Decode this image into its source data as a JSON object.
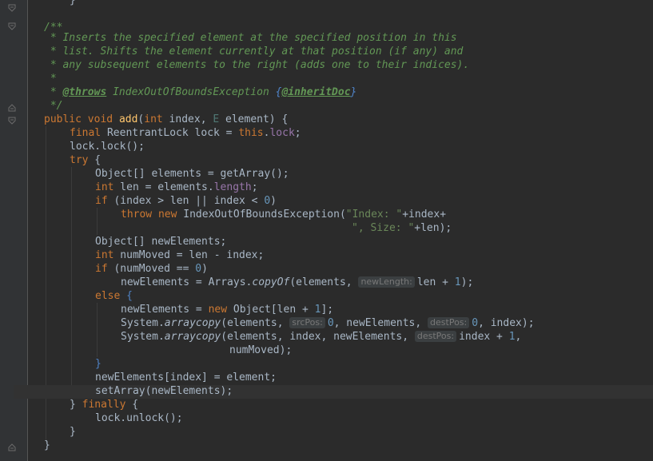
{
  "editor": {
    "language": "java",
    "colors": {
      "background": "#2b2b2b",
      "gutter": "#313335",
      "keyword": "#cc7832",
      "comment": "#629755",
      "method": "#ffc66d",
      "field": "#9876aa",
      "number": "#6897bb",
      "string": "#6a8759",
      "text": "#a9b7c6"
    },
    "fold_icons": [
      "fold-open-icon",
      "fold-open-icon",
      "fold-close-icon",
      "fold-open-icon",
      "fold-close-icon"
    ],
    "lines": [
      "}",
      "",
      "/**",
      " * Inserts the specified element at the specified position in this",
      " * list. Shifts the element currently at that position (if any) and",
      " * any subsequent elements to the right (adds one to their indices).",
      " *",
      " * @throws IndexOutOfBoundsException {@inheritDoc}",
      " */",
      "public void add(int index, E element) {",
      "final ReentrantLock lock = this.lock;",
      "lock.lock();",
      "try {",
      "Object[] elements = getArray();",
      "int len = elements.length;",
      "if (index > len || index < 0)",
      "throw new IndexOutOfBoundsException(\"Index: \"+index+",
      "\", Size: \"+len);",
      "Object[] newElements;",
      "int numMoved = len - index;",
      "if (numMoved == 0)",
      "newElements = Arrays.copyOf(elements, newLength: len + 1);",
      "else {",
      "newElements = new Object[len + 1];",
      "System.arraycopy(elements, srcPos: 0, newElements, destPos: 0, index);",
      "System.arraycopy(elements, index, newElements, destPos: index + 1,",
      "numMoved);",
      "}",
      "newElements[index] = element;",
      "setArray(newElements);",
      "} finally {",
      "lock.unlock();",
      "}",
      "}"
    ],
    "tokens": {
      "t_close0": "}",
      "c_open": "/**",
      "c1": " * Inserts the specified element at the specified position in this",
      "c2": " * list. Shifts the element currently at that position (if any) and",
      "c3": " * any subsequent elements to the right (adds one to their indices).",
      "c4": " *",
      "c5_star": " * ",
      "c5_throws": "@throws",
      "c5_ex": " IndexOutOfBoundsException ",
      "c5_lb": "{",
      "c5_inherit": "@inheritDoc",
      "c5_rb": "}",
      "c_close": " */",
      "public": "public",
      "void": "void",
      "add": "add",
      "int": "int",
      "final": "final",
      "this": "this",
      "lock_field": "lock",
      "try": "try",
      "length": "length",
      "if": "if",
      "throw": "throw",
      "new": "new",
      "else": "else",
      "finally": "finally",
      "zero": "0",
      "one": "1",
      "str_index": "\"Index: \"",
      "str_size": "\", Size: \"",
      "hint_newLength": "newLength:",
      "hint_srcPos": "srcPos:",
      "hint_destPos": "destPos:",
      "copyOf": "copyOf",
      "arraycopy": "arraycopy"
    }
  }
}
